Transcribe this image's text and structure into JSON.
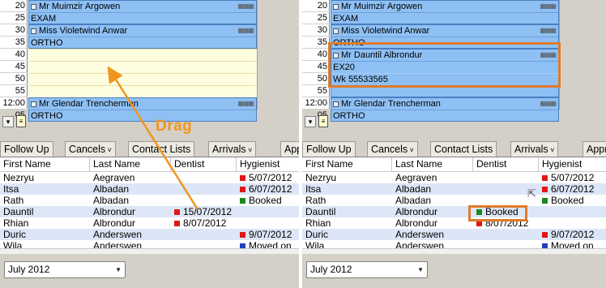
{
  "left": {
    "times": [
      "20",
      "25",
      "30",
      "35",
      "40",
      "45",
      "50",
      "55",
      "12:00",
      "05"
    ],
    "appointments": [
      {
        "name": "Mr Muimzir Argowen",
        "lines": [
          "EXAM"
        ],
        "row": 0,
        "span": 2
      },
      {
        "name": "Miss Violetwind Anwar",
        "lines": [
          "ORTHO"
        ],
        "row": 2,
        "span": 2
      },
      {
        "name": "Mr Glendar Trencherman",
        "lines": [
          "ORTHO"
        ],
        "row": 8,
        "span": 2
      }
    ],
    "tabs": [
      "Follow Up",
      "Cancels",
      "Contact Lists",
      "Arrivals",
      "Approva"
    ],
    "columns": [
      "First Name",
      "Last Name",
      "Dentist",
      "Hygienist"
    ],
    "rows": [
      {
        "first": "Nezryu",
        "last": "Aegraven",
        "dentist": "",
        "dentist_color": "",
        "hyg": "5/07/2012",
        "hyg_color": "red"
      },
      {
        "first": "Itsa",
        "last": "Albadan",
        "dentist": "",
        "dentist_color": "",
        "hyg": "6/07/2012",
        "hyg_color": "red"
      },
      {
        "first": "Rath",
        "last": "Albadan",
        "dentist": "",
        "dentist_color": "",
        "hyg": "Booked",
        "hyg_color": "green"
      },
      {
        "first": "Dauntil",
        "last": "Albrondur",
        "dentist": "15/07/2012",
        "dentist_color": "red",
        "hyg": "",
        "hyg_color": ""
      },
      {
        "first": "Rhian",
        "last": "Albrondur",
        "dentist": "8/07/2012",
        "dentist_color": "red",
        "hyg": "",
        "hyg_color": ""
      },
      {
        "first": "Duric",
        "last": "Anderswen",
        "dentist": "",
        "dentist_color": "",
        "hyg": "9/07/2012",
        "hyg_color": "red"
      },
      {
        "first": "Wila",
        "last": "Anderswen",
        "dentist": "",
        "dentist_color": "",
        "hyg": "Moved on",
        "hyg_color": "blue"
      }
    ],
    "month": "July 2012",
    "drag_label": "Drag"
  },
  "right": {
    "times": [
      "20",
      "25",
      "30",
      "35",
      "40",
      "45",
      "50",
      "55",
      "12:00",
      "05"
    ],
    "appointments": [
      {
        "name": "Mr Muimzir Argowen",
        "lines": [
          "EXAM"
        ],
        "row": 0,
        "span": 2
      },
      {
        "name": "Miss Violetwind Anwar",
        "lines": [
          "ORTHO"
        ],
        "row": 2,
        "span": 2
      },
      {
        "name": "Mr Dauntil Albrondur",
        "lines": [
          "EX20",
          "Wk 55533565",
          ""
        ],
        "row": 4,
        "span": 4
      },
      {
        "name": "Mr Glendar Trencherman",
        "lines": [
          "ORTHO"
        ],
        "row": 8,
        "span": 2
      }
    ],
    "tabs": [
      "Follow Up",
      "Cancels",
      "Contact Lists",
      "Arrivals",
      "Approva"
    ],
    "columns": [
      "First Name",
      "Last Name",
      "Dentist",
      "Hygienist"
    ],
    "rows": [
      {
        "first": "Nezryu",
        "last": "Aegraven",
        "dentist": "",
        "dentist_color": "",
        "hyg": "5/07/2012",
        "hyg_color": "red"
      },
      {
        "first": "Itsa",
        "last": "Albadan",
        "dentist": "",
        "dentist_color": "",
        "hyg": "6/07/2012",
        "hyg_color": "red"
      },
      {
        "first": "Rath",
        "last": "Albadan",
        "dentist": "",
        "dentist_color": "",
        "hyg": "Booked",
        "hyg_color": "green"
      },
      {
        "first": "Dauntil",
        "last": "Albrondur",
        "dentist": "Booked",
        "dentist_color": "green",
        "hyg": "",
        "hyg_color": ""
      },
      {
        "first": "Rhian",
        "last": "Albrondur",
        "dentist": "8/07/2012",
        "dentist_color": "red",
        "hyg": "",
        "hyg_color": ""
      },
      {
        "first": "Duric",
        "last": "Anderswen",
        "dentist": "",
        "dentist_color": "",
        "hyg": "9/07/2012",
        "hyg_color": "red"
      },
      {
        "first": "Wila",
        "last": "Anderswen",
        "dentist": "",
        "dentist_color": "",
        "hyg": "Moved on",
        "hyg_color": "blue"
      }
    ],
    "month": "July 2012"
  },
  "colors": {
    "appointment": "#8ec0f4",
    "highlight": "#e07b2a",
    "drag_arrow": "#f0961e",
    "alt_row": "#dde6f6",
    "empty_slot": "#fffde0"
  },
  "icons": {
    "toolbar_dropdown": "chevron-down-icon",
    "clipboard": "clipboard-icon",
    "status_square": "status-square-icon"
  }
}
